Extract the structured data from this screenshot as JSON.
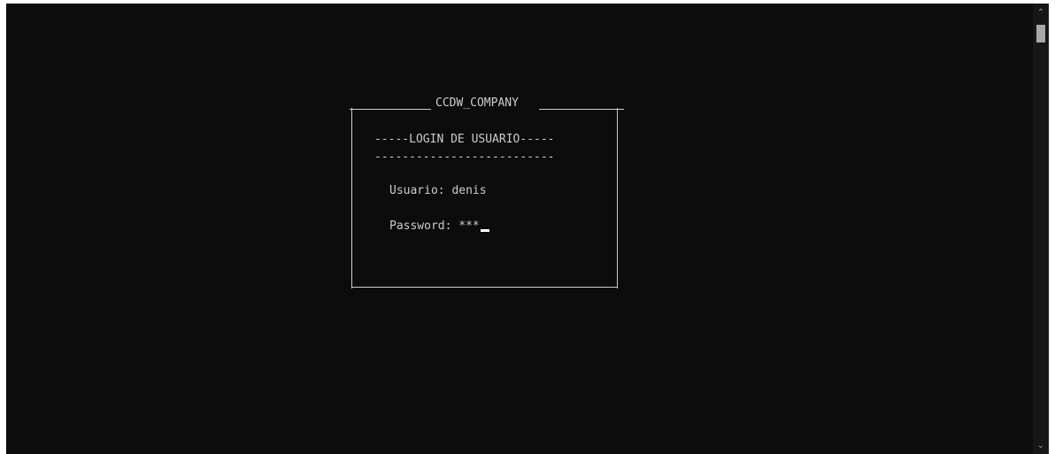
{
  "login_box": {
    "title": "CCDW_COMPANY",
    "heading": "-----LOGIN DE USUARIO-----",
    "separator": "--------------------------",
    "user_label": "Usuario:",
    "user_value": "denis",
    "password_label": "Password:",
    "password_value": "***"
  },
  "icons": {
    "scroll_up": "chevron-up-icon",
    "scroll_down": "chevron-down-icon"
  },
  "colors": {
    "background": "#0c0c0c",
    "text": "#cccccc",
    "cursor": "#ffffff"
  }
}
